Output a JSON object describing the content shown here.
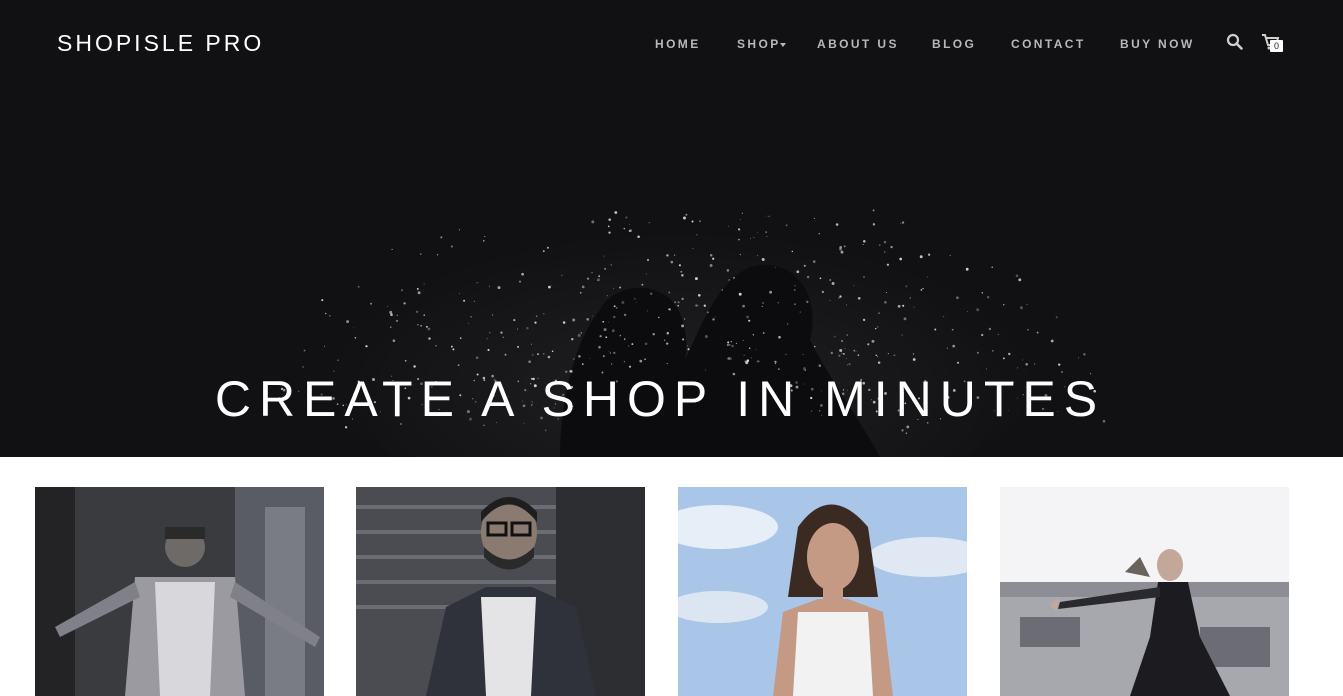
{
  "header": {
    "brand": "SHOPISLE PRO",
    "nav": [
      {
        "label": "HOME"
      },
      {
        "label": "SHOP"
      },
      {
        "label": "ABOUT US"
      },
      {
        "label": "BLOG"
      },
      {
        "label": "CONTACT"
      },
      {
        "label": "BUY NOW"
      }
    ],
    "cart_count": "0",
    "icons": [
      "search-icon",
      "cart-icon",
      "chevron-down-icon"
    ]
  },
  "hero": {
    "title": "CREATE A SHOP IN MINUTES"
  },
  "colors": {
    "hero_bg": "#111113",
    "nav_text": "#b8b8b8",
    "brand_text": "#ffffff"
  }
}
